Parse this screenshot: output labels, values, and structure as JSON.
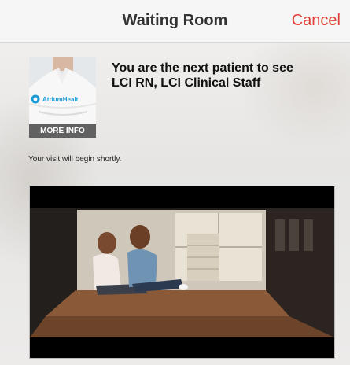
{
  "navbar": {
    "title": "Waiting Room",
    "cancel_label": "Cancel",
    "cancel_color": "#e0403a"
  },
  "provider": {
    "more_info_label": "MORE INFO",
    "brand_label": "AtriumHealt"
  },
  "headline": {
    "line1": "You are the next patient to see",
    "line2": "LCI RN, LCI Clinical Staff"
  },
  "status_text": "Your visit will begin shortly.",
  "video": {
    "icon": "waiting-room-video"
  }
}
